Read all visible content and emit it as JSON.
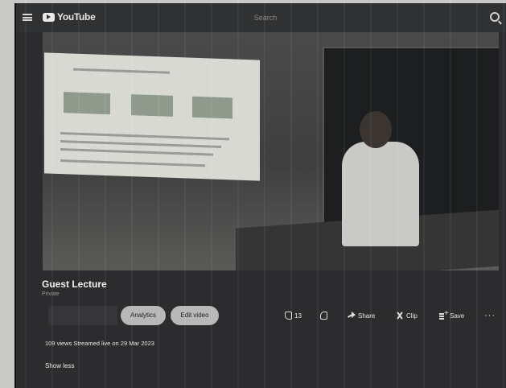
{
  "header": {
    "logo_text": "YouTube",
    "search_placeholder": "Search"
  },
  "video": {
    "title": "Guest Lecture",
    "privacy": "Private"
  },
  "actions": {
    "analytics_label": "Analytics",
    "edit_video_label": "Edit video",
    "like_count": "13",
    "share_label": "Share",
    "clip_label": "Clip",
    "save_label": "Save",
    "more_label": "···"
  },
  "description": {
    "meta_text": "109 views  Streamed live on 29 Mar 2023",
    "show_less_label": "Show less"
  },
  "colors": {
    "page_background": "#2c2c2e",
    "pill_background": "#b8b8b6",
    "text_primary": "#f2f2f2"
  },
  "icons": [
    "menu-icon",
    "youtube-logo-icon",
    "search-icon",
    "thumbs-up-icon",
    "thumbs-down-icon",
    "share-icon",
    "clip-icon",
    "save-icon",
    "more-icon"
  ]
}
